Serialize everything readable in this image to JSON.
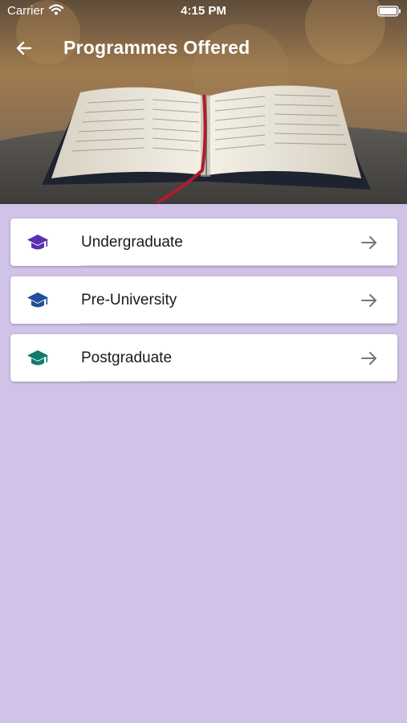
{
  "status_bar": {
    "carrier": "Carrier",
    "time": "4:15 PM",
    "wifi_icon": "wifi-icon",
    "battery_icon": "battery-icon"
  },
  "nav": {
    "back_icon": "arrow-left-icon",
    "title": "Programmes Offered"
  },
  "header_image": "open-book-photo",
  "programmes": [
    {
      "label": "Undergraduate",
      "icon": "graduation-cap-icon",
      "icon_color": "#5b2fb0",
      "arrow_icon": "arrow-right-icon"
    },
    {
      "label": "Pre-University",
      "icon": "graduation-cap-icon",
      "icon_color": "#1f4f9a",
      "arrow_icon": "arrow-right-icon"
    },
    {
      "label": "Postgraduate",
      "icon": "graduation-cap-icon",
      "icon_color": "#127a6e",
      "arrow_icon": "arrow-right-icon"
    }
  ],
  "colors": {
    "background": "#d1c2e8",
    "card": "#ffffff",
    "arrow": "#757575"
  }
}
